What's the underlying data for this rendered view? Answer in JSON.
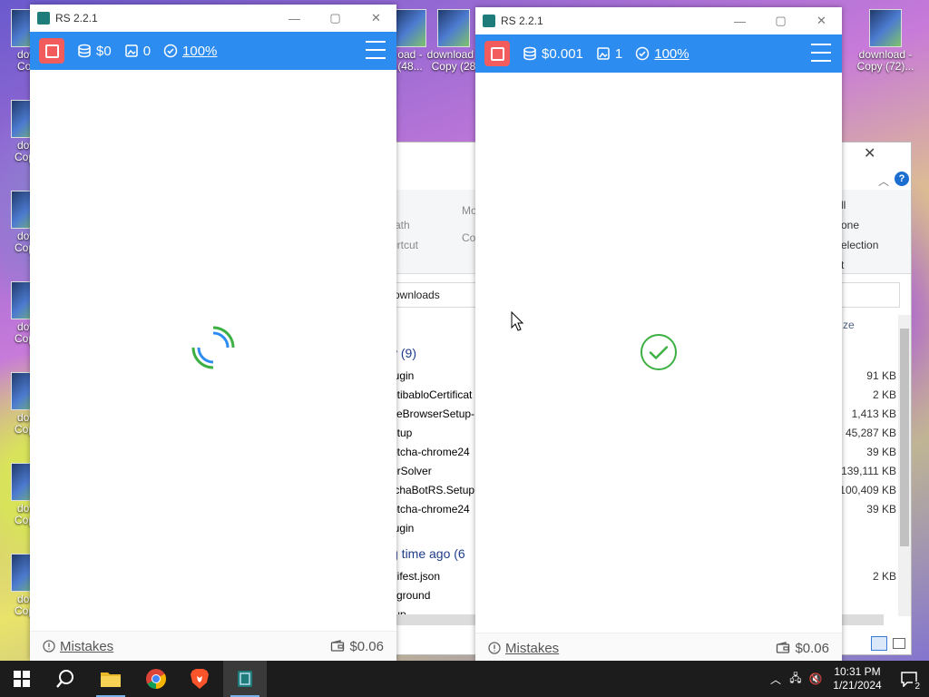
{
  "desktop": {
    "icon_labels": [
      "dow\nCop",
      "dow\nCopy",
      "dow\nCopy",
      "dow\nCopy",
      "dow\nCopy",
      "dow\nCopy",
      "dow\nCopy"
    ],
    "right_icons": [
      {
        "label": "download -\nCopy (72)..."
      },
      {
        "label": "download -\nCopy (28"
      },
      {
        "label": "oad -\n(48..."
      }
    ]
  },
  "explorer": {
    "ribbon_left": [
      "ath",
      "ortcut"
    ],
    "ribbon_mid": [
      "Mo",
      "Co"
    ],
    "ribbon_right": [
      "ll",
      "one",
      "election",
      "t"
    ],
    "address": "ownloads",
    "size_header": "ze",
    "group1": "y (9)",
    "group2": "g time ago (6",
    "files1": [
      {
        "name": "lugin",
        "size": "91 KB"
      },
      {
        "name": "otibabloCertificat",
        "size": "2 KB"
      },
      {
        "name": "veBrowserSetup-",
        "size": "1,413 KB"
      },
      {
        "name": "etup",
        "size": "45,287 KB"
      },
      {
        "name": "otcha-chrome24",
        "size": "39 KB"
      },
      {
        "name": "erSolver",
        "size": "139,111 KB"
      },
      {
        "name": "tchaBotRS.Setup",
        "size": "100,409 KB"
      },
      {
        "name": "otcha-chrome24",
        "size": "39 KB"
      },
      {
        "name": "lugin",
        "size": ""
      }
    ],
    "files2": [
      {
        "name": "nifest.json",
        "size": "2 KB"
      },
      {
        "name": "kground",
        "size": ""
      },
      {
        "name": "tup",
        "size": ""
      }
    ]
  },
  "window1": {
    "title": "RS 2.2.1",
    "balance": "$0",
    "count": "0",
    "rate": "100%",
    "mistakes": "Mistakes",
    "wallet": "$0.06",
    "state": "loading"
  },
  "window2": {
    "title": "RS 2.2.1",
    "balance": "$0.001",
    "count": "1",
    "rate": "100%",
    "mistakes": "Mistakes",
    "wallet": "$0.06",
    "state": "success"
  },
  "taskbar": {
    "time": "10:31 PM",
    "date": "1/21/2024",
    "notifications": "2"
  },
  "colors": {
    "toolbar": "#2d8cf0",
    "stop": "#f25c5c",
    "success": "#3cb043"
  }
}
